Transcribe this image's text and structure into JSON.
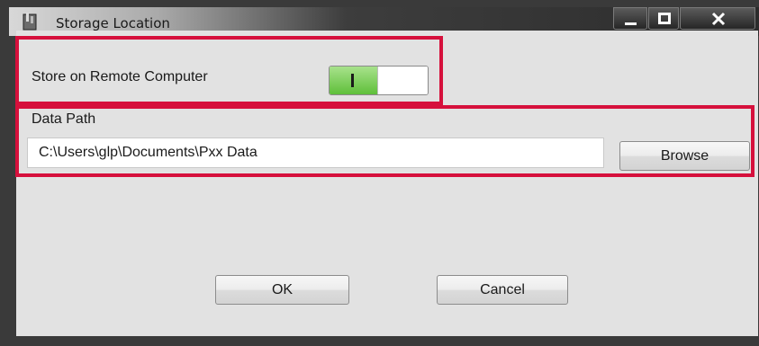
{
  "window": {
    "title": "Storage Location",
    "icon": "app-icon",
    "controls": [
      "minimize-icon",
      "maximize-icon",
      "close-icon"
    ]
  },
  "remote": {
    "label": "Store on Remote Computer",
    "toggle_state": "on",
    "toggle_glyph": "I"
  },
  "data_path": {
    "label": "Data Path",
    "value": "C:\\Users\\glp\\Documents\\Pxx Data",
    "browse_label": "Browse"
  },
  "actions": {
    "ok_label": "OK",
    "cancel_label": "Cancel"
  },
  "colors": {
    "highlight": "#d6103c",
    "toggle_on": "#5fbf3a"
  }
}
